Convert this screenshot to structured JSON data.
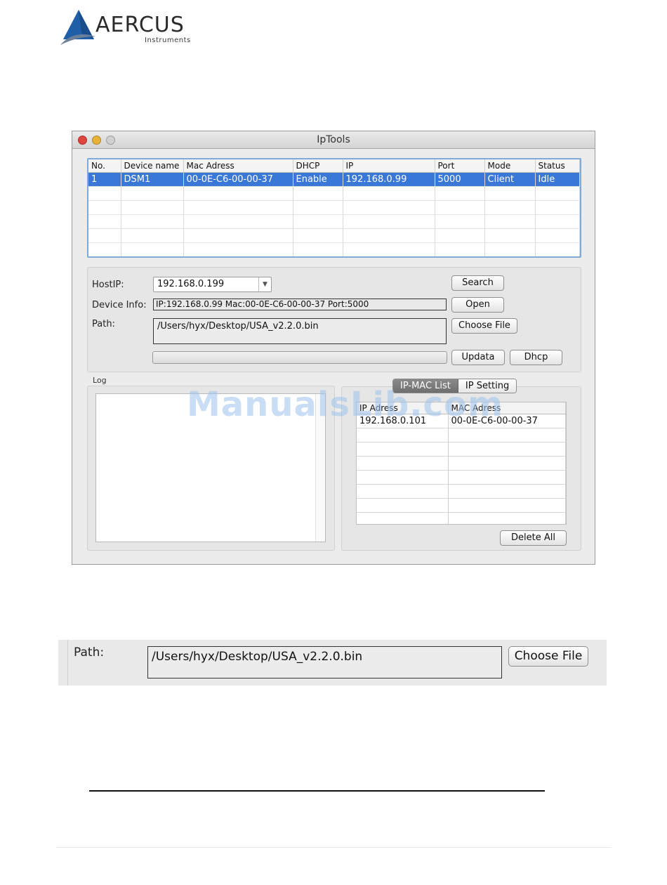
{
  "logo": {
    "brand": "AERCUS",
    "sub": "Instruments",
    "colors": {
      "mark": "#1f5fa8",
      "mark_dark": "#5d6f86"
    }
  },
  "window": {
    "title": "IpTools",
    "device_table": {
      "columns": [
        "No.",
        "Device name",
        "Mac Adress",
        "DHCP",
        "IP",
        "Port",
        "Mode",
        "Status"
      ],
      "rows": [
        [
          "1",
          "DSM1",
          "00-0E-C6-00-00-37",
          "Enable",
          "192.168.0.99",
          "5000",
          "Client",
          "Idle"
        ]
      ],
      "selected_color": "#3a78d8"
    },
    "controls": {
      "host_ip_label": "HostIP:",
      "host_ip_value": "192.168.0.199",
      "device_info_label": "Device Info:",
      "device_info_value": "IP:192.168.0.99     Mac:00-0E-C6-00-00-37     Port:5000",
      "path_label": "Path:",
      "path_value": "/Users/hyx/Desktop/USA_v2.2.0.bin",
      "search_btn": "Search",
      "open_btn": "Open",
      "choose_file_btn": "Choose File",
      "updata_btn": "Updata",
      "dhcp_btn": "Dhcp",
      "progress": 0
    },
    "log": {
      "label": "Log"
    },
    "tabs": {
      "ip_mac_list": "IP-MAC List",
      "ip_setting": "IP Setting"
    },
    "mac_table": {
      "columns": [
        "IP Adress",
        "MAC Adress"
      ],
      "rows": [
        [
          "192.168.0.101",
          "00-0E-C6-00-00-37"
        ]
      ]
    },
    "delete_all_btn": "Delete All"
  },
  "watermark": "ManualsLib.com",
  "zoom": {
    "path_label": "Path:",
    "path_value": "/Users/hyx/Desktop/USA_v2.2.0.bin",
    "choose_file_btn": "Choose File"
  }
}
